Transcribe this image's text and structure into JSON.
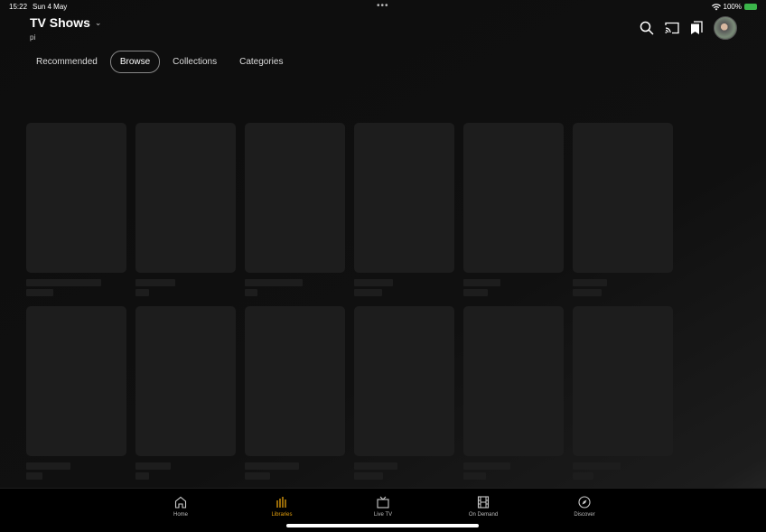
{
  "status_bar": {
    "time": "15:22",
    "date": "Sun 4 May",
    "battery": "100%"
  },
  "header": {
    "title": "TV Shows",
    "subtitle": "pi"
  },
  "tabs": [
    {
      "label": "Recommended",
      "active": false
    },
    {
      "label": "Browse",
      "active": true
    },
    {
      "label": "Collections",
      "active": false
    },
    {
      "label": "Categories",
      "active": false
    }
  ],
  "toolbar_icons": [
    "search-icon",
    "cast-icon",
    "watchlist-icon",
    "avatar"
  ],
  "grid": {
    "rows": 2,
    "columns": 6,
    "state": "loading-placeholders"
  },
  "bottom_nav": [
    {
      "label": "Home",
      "icon": "home-icon",
      "active": false
    },
    {
      "label": "Libraries",
      "icon": "libraries-icon",
      "active": true
    },
    {
      "label": "Live TV",
      "icon": "tv-icon",
      "active": false
    },
    {
      "label": "On Demand",
      "icon": "film-icon",
      "active": false
    },
    {
      "label": "Discover",
      "icon": "compass-icon",
      "active": false
    }
  ],
  "colors": {
    "accent": "#e5a00d",
    "background": "#0e0e0e",
    "placeholder": "#1d1d1d",
    "battery": "#3bb54a"
  }
}
